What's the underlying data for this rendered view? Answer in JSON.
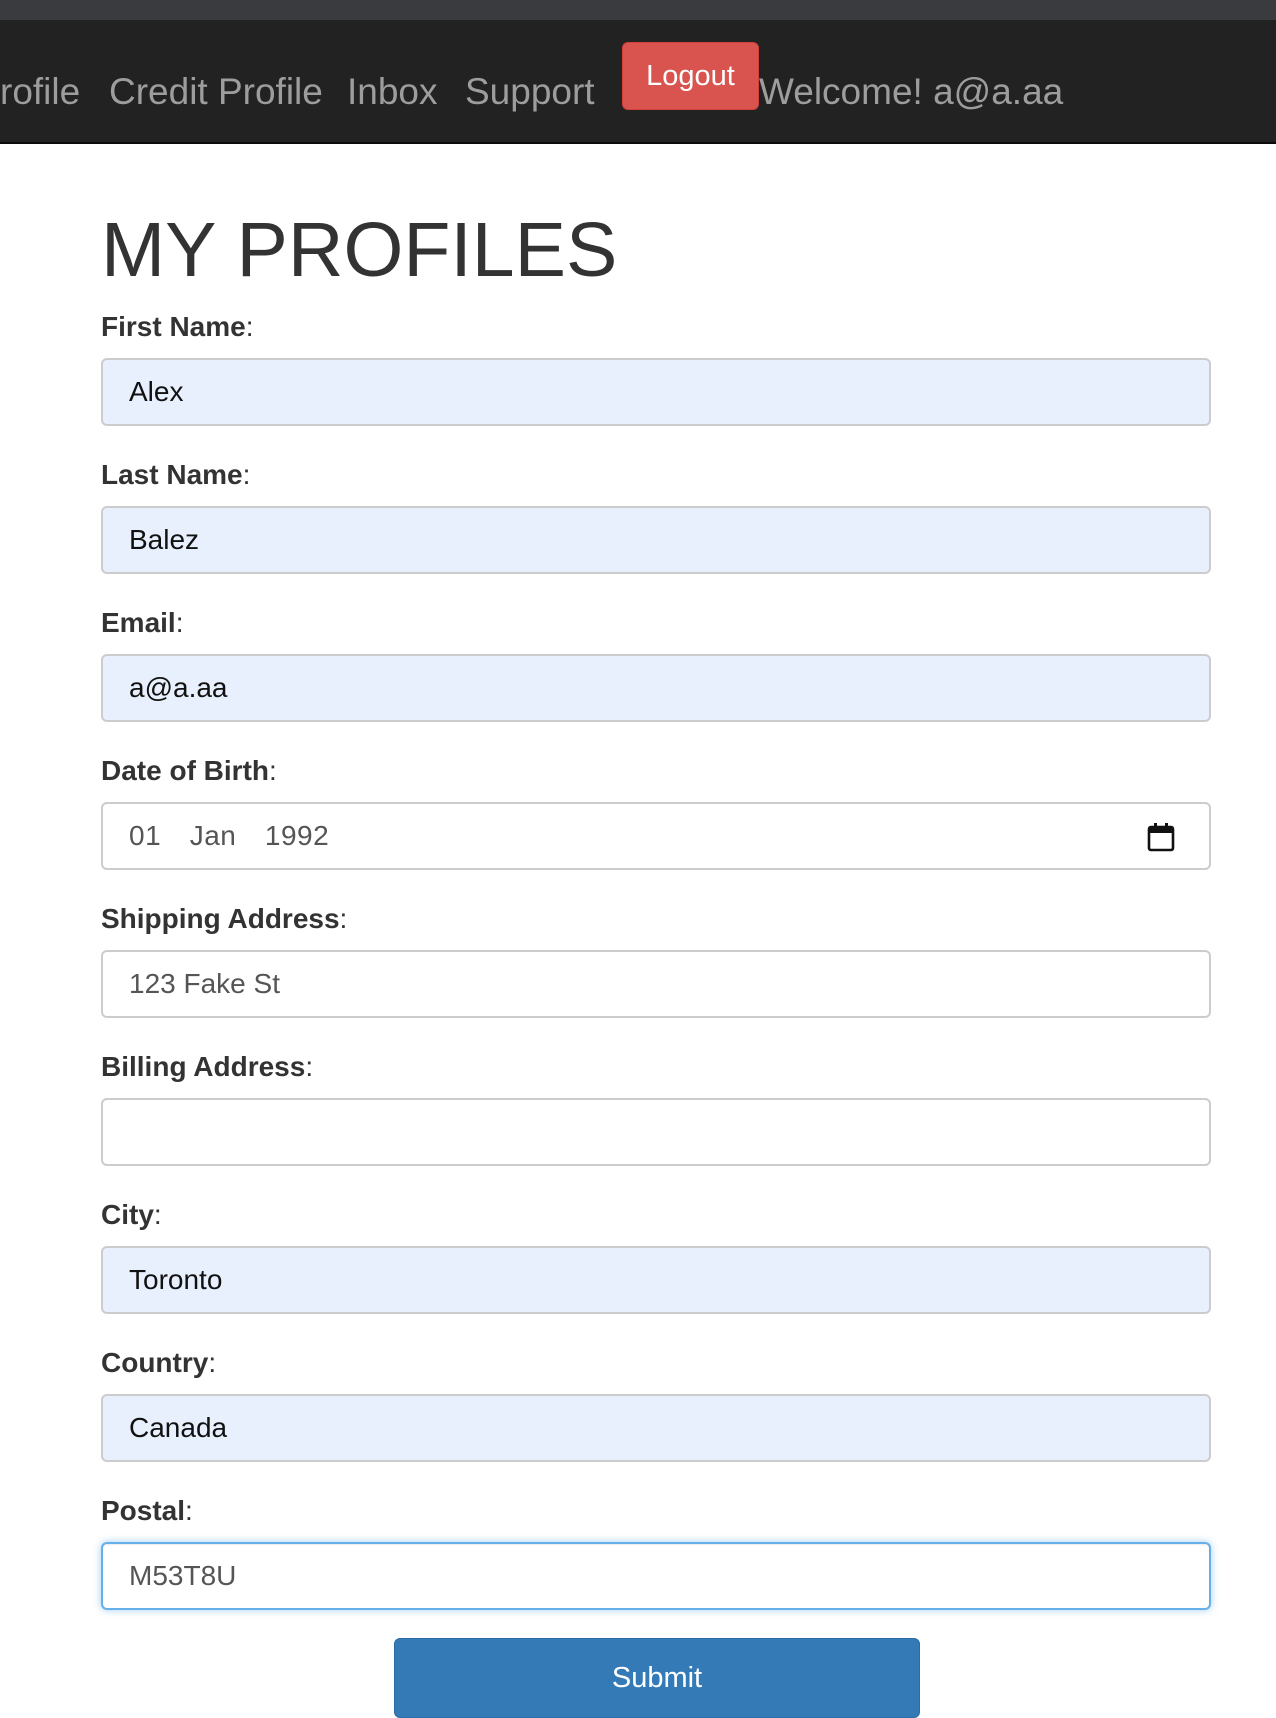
{
  "nav": {
    "items": [
      "rofile",
      "Credit Profile",
      "Inbox",
      "Support"
    ],
    "logout_label": "Logout",
    "welcome": "Welcome! a@a.aa"
  },
  "page": {
    "title": "MY PROFILES"
  },
  "form": {
    "first_name": {
      "label": "First Name",
      "value": "Alex"
    },
    "last_name": {
      "label": "Last Name",
      "value": "Balez"
    },
    "email": {
      "label": "Email",
      "value": "a@a.aa"
    },
    "dob": {
      "label": "Date of Birth",
      "value": "01  Jan  1992"
    },
    "shipping": {
      "label": "Shipping Address",
      "value": "123 Fake St"
    },
    "billing": {
      "label": "Billing Address",
      "value": ""
    },
    "city": {
      "label": "City",
      "value": "Toronto"
    },
    "country": {
      "label": "Country",
      "value": "Canada"
    },
    "postal": {
      "label": "Postal",
      "value": "M53T8U"
    },
    "submit_label": "Submit"
  },
  "colors": {
    "navbar": "#222222",
    "logout": "#d9534f",
    "submit": "#337ab7",
    "autofill": "#e8f0fe"
  },
  "icons": {
    "date_picker": "calendar-icon"
  }
}
